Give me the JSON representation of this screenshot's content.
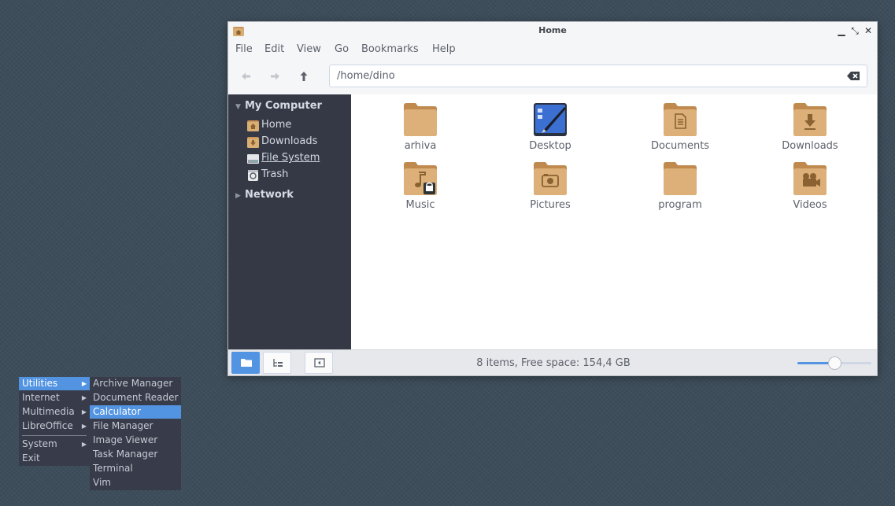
{
  "window": {
    "title": "Home",
    "controls": {
      "minimize": "▁",
      "maximize": "⤡",
      "close": "✕"
    }
  },
  "menubar": [
    "File",
    "Edit",
    "View",
    "Go",
    "Bookmarks",
    "Help"
  ],
  "toolbar": {
    "back_icon": "arrow-left-icon",
    "forward_icon": "arrow-right-icon",
    "up_icon": "arrow-up-icon",
    "location": "/home/dino",
    "clear_icon": "clear-text-icon"
  },
  "sidebar": {
    "sections": [
      {
        "label": "My Computer",
        "expanded": true
      },
      {
        "label": "Network",
        "expanded": false
      }
    ],
    "expanded_marker": "▼",
    "collapsed_marker": "▶",
    "items": [
      {
        "label": "Home",
        "icon": "home-folder-icon"
      },
      {
        "label": "Downloads",
        "icon": "downloads-folder-icon"
      },
      {
        "label": "File System",
        "icon": "drive-icon"
      },
      {
        "label": "Trash",
        "icon": "trash-icon"
      }
    ]
  },
  "files": [
    {
      "name": "arhiva",
      "icon": "folder-icon"
    },
    {
      "name": "Desktop",
      "icon": "desktop-icon"
    },
    {
      "name": "Documents",
      "icon": "documents-folder-icon"
    },
    {
      "name": "Downloads",
      "icon": "downloads-folder-icon"
    },
    {
      "name": "Music",
      "icon": "music-folder-icon"
    },
    {
      "name": "Pictures",
      "icon": "pictures-folder-icon"
    },
    {
      "name": "program",
      "icon": "folder-icon"
    },
    {
      "name": "Videos",
      "icon": "videos-folder-icon"
    }
  ],
  "statusbar": {
    "text": "8 items, Free space: 154,4 GB",
    "zoom_level": 0.5
  },
  "app_menu": {
    "items": [
      {
        "label": "Utilities",
        "has_submenu": true,
        "selected": true
      },
      {
        "label": "Internet",
        "has_submenu": true,
        "selected": false
      },
      {
        "label": "Multimedia",
        "has_submenu": true,
        "selected": false
      },
      {
        "label": "LibreOffice",
        "has_submenu": true,
        "selected": false
      },
      {
        "label": "System",
        "has_submenu": true,
        "selected": false
      },
      {
        "label": "Exit",
        "has_submenu": false,
        "selected": false
      }
    ],
    "arrow": "▶",
    "submenu": [
      {
        "label": "Archive Manager",
        "selected": false
      },
      {
        "label": "Document Reader",
        "selected": false
      },
      {
        "label": "Calculator",
        "selected": true
      },
      {
        "label": "File Manager",
        "selected": false
      },
      {
        "label": "Image Viewer",
        "selected": false
      },
      {
        "label": "Task Manager",
        "selected": false
      },
      {
        "label": "Terminal",
        "selected": false
      },
      {
        "label": "Vim",
        "selected": false
      }
    ]
  },
  "colors": {
    "accent": "#5294e2",
    "sidebar_bg": "#353945",
    "folder": "#d9ae73",
    "desktop_bg": "#3d4d5a",
    "menu_bg": "#383c4a"
  }
}
